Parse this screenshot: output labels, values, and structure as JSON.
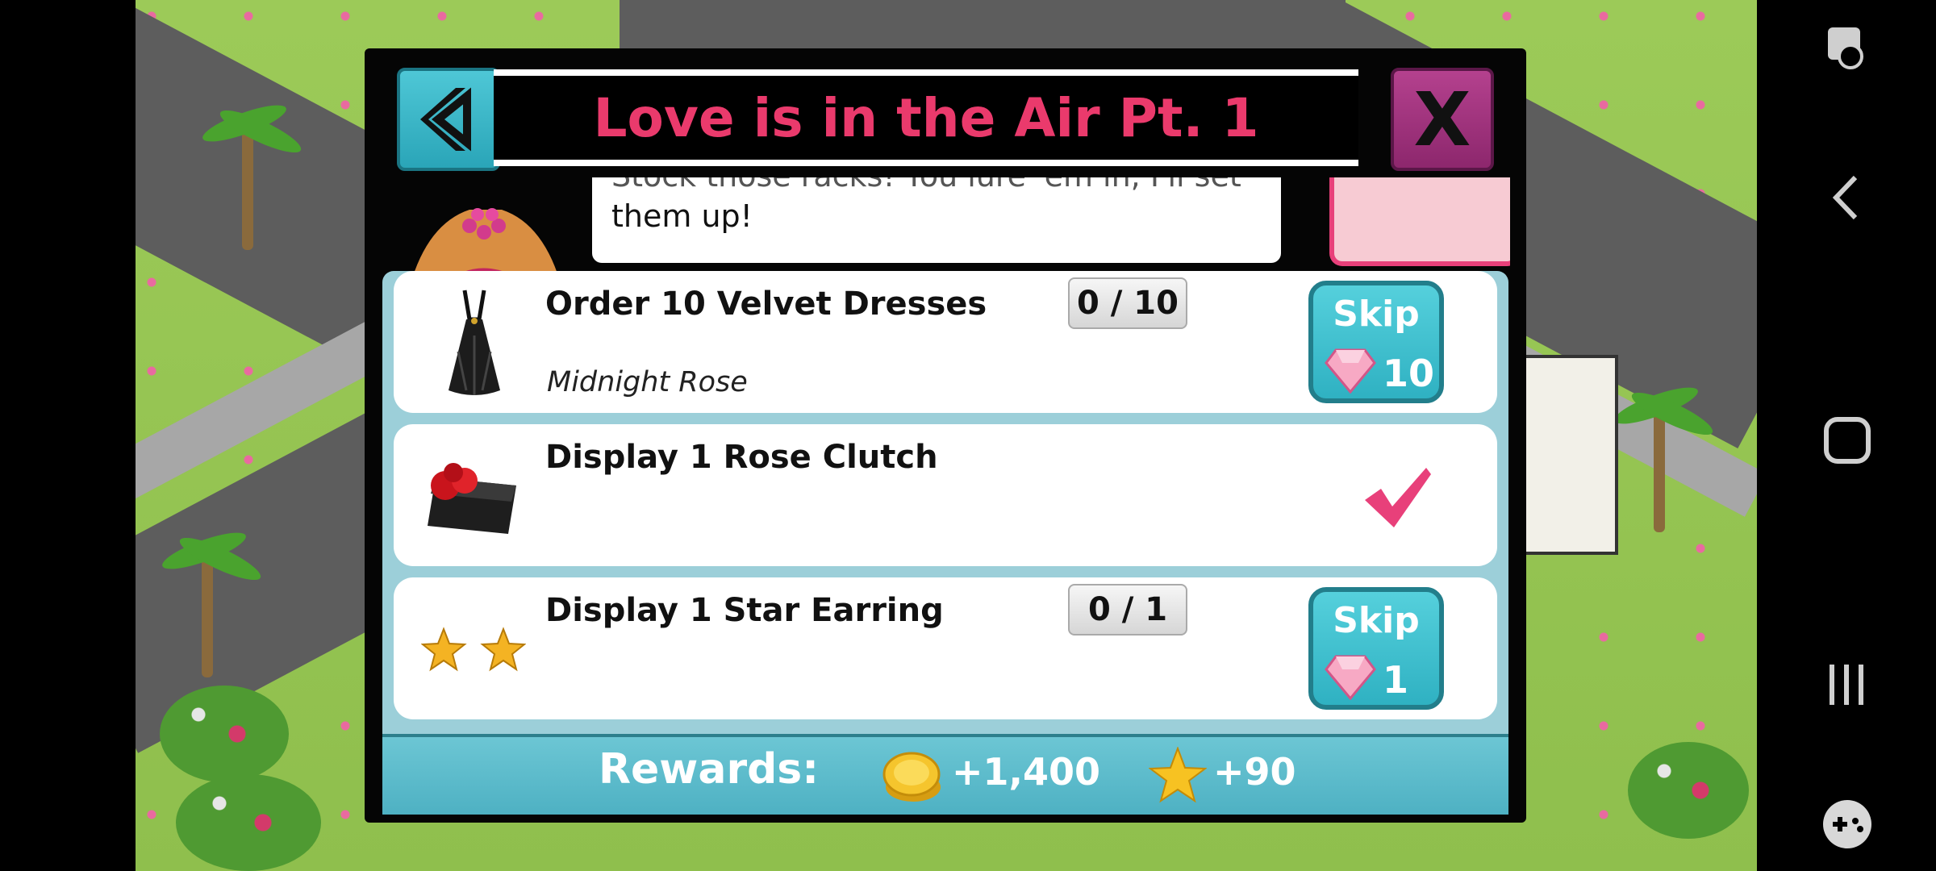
{
  "dialog": {
    "title": "Love is in the Air Pt. 1",
    "close_label": "X",
    "speech_hidden_line": "Stock those racks! You lure 'em in, I'll set",
    "speech_visible_line": "them up!"
  },
  "tasks": [
    {
      "title": "Order 10 Velvet Dresses",
      "subtitle": "Midnight Rose",
      "progress": "0 / 10",
      "skip_label": "Skip",
      "skip_cost": "10",
      "completed": false,
      "icon": "black-dress-icon"
    },
    {
      "title": "Display 1 Rose Clutch",
      "subtitle": "",
      "progress": "",
      "completed": true,
      "icon": "rose-clutch-icon"
    },
    {
      "title": "Display 1 Star Earring",
      "subtitle": "",
      "progress": "0 / 1",
      "skip_label": "Skip",
      "skip_cost": "1",
      "completed": false,
      "icon": "star-earring-icon"
    }
  ],
  "rewards": {
    "label": "Rewards:",
    "coins": "+1,400",
    "stars": "+90"
  },
  "colors": {
    "title": "#ea3a6c",
    "skip_button": "#3fc0ce",
    "panel": "#9ccfd9",
    "check": "#e8407a"
  },
  "system_nav": {
    "icons": [
      "screenshot-toggle-icon",
      "back-icon",
      "home-icon",
      "recents-icon",
      "game-tools-icon"
    ]
  }
}
